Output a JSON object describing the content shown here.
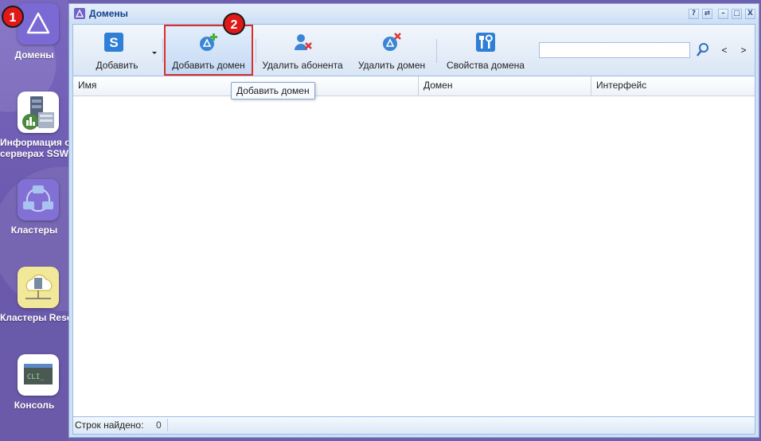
{
  "dock": {
    "items": [
      {
        "label": "Домены",
        "icon": "domain-triangle-icon",
        "active": true
      },
      {
        "label_lines": [
          "Информация о",
          "серверах SSW"
        ],
        "icon": "server-info-icon"
      },
      {
        "label": "Кластеры",
        "icon": "cluster-icon"
      },
      {
        "label": "Кластеры Resource",
        "icon": "resource-cluster-icon"
      },
      {
        "label": "Консоль",
        "icon": "console-icon",
        "icon_text": "CLI_"
      }
    ]
  },
  "annotations": {
    "step1": "1",
    "step2": "2"
  },
  "window": {
    "title": "Домены",
    "controls": {
      "help": "?",
      "refresh": "⇄",
      "minimize": "–",
      "maximize": "□",
      "close": "X"
    }
  },
  "toolbar": {
    "add_label": "Добавить",
    "add_domain_label": "Добавить домен",
    "delete_subscriber_label": "Удалить абонента",
    "delete_domain_label": "Удалить домен",
    "domain_properties_label": "Свойства домена",
    "search_value": "",
    "prev": "<",
    "next": ">"
  },
  "tooltip": "Добавить домен",
  "grid": {
    "columns": [
      "Имя",
      "Домен",
      "Интерфейс"
    ],
    "rows": []
  },
  "status": {
    "rows_found_label": "Строк найдено:",
    "rows_found_value": "0"
  },
  "colors": {
    "accent": "#6f62c9",
    "highlight_border": "#d9302c",
    "badge": "#e01818",
    "title_text": "#15428b"
  }
}
